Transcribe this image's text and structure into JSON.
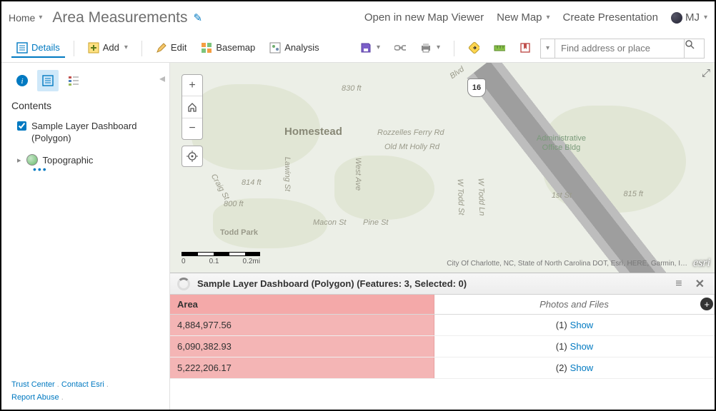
{
  "header": {
    "home": "Home",
    "title": "Area Measurements",
    "open_viewer": "Open in new Map Viewer",
    "new_map": "New Map",
    "create_presentation": "Create Presentation",
    "user_initials": "MJ"
  },
  "toolbar": {
    "details": "Details",
    "add": "Add",
    "edit": "Edit",
    "basemap": "Basemap",
    "analysis": "Analysis"
  },
  "search": {
    "placeholder": "Find address or place"
  },
  "sidebar": {
    "contents": "Contents",
    "layer": "Sample Layer Dashboard (Polygon)",
    "basemap": "Topographic",
    "footer": {
      "trust": "Trust Center",
      "contact": "Contact Esri",
      "report": "Report Abuse"
    }
  },
  "map": {
    "homestead": "Homestead",
    "toddpark": "Todd Park",
    "admin": "Administrative\nOffice Bldg",
    "shield": "16",
    "roads": {
      "rozzelles": "Rozzelles Ferry Rd",
      "mtholly": "Old Mt Holly Rd",
      "blvd": "Blvd",
      "first": "1st St",
      "macon": "Macon St",
      "pine": "Pine St",
      "west": "West Ave",
      "lawing": "Lawing St",
      "craig": "Craig St",
      "todd_ln": "W Todd Ln",
      "todd_st": "W Todd St",
      "ft830": "830 ft",
      "ft814": "814 ft",
      "ft800": "800 ft",
      "ft815": "815 ft"
    },
    "scale": {
      "a": "0",
      "b": "0.1",
      "c": "0.2mi"
    },
    "attribution": "City Of Charlotte, NC, State of North Carolina DOT, Esri, HERE, Garmin, I…",
    "esri": "esri"
  },
  "table": {
    "title": "Sample Layer Dashboard (Polygon) (Features: 3, Selected: 0)",
    "col_area": "Area",
    "col_photos": "Photos and Files",
    "rows": [
      {
        "area": "4,884,977.56",
        "count": "(1)",
        "show": "Show"
      },
      {
        "area": "6,090,382.93",
        "count": "(1)",
        "show": "Show"
      },
      {
        "area": "5,222,206.17",
        "count": "(2)",
        "show": "Show"
      }
    ]
  }
}
